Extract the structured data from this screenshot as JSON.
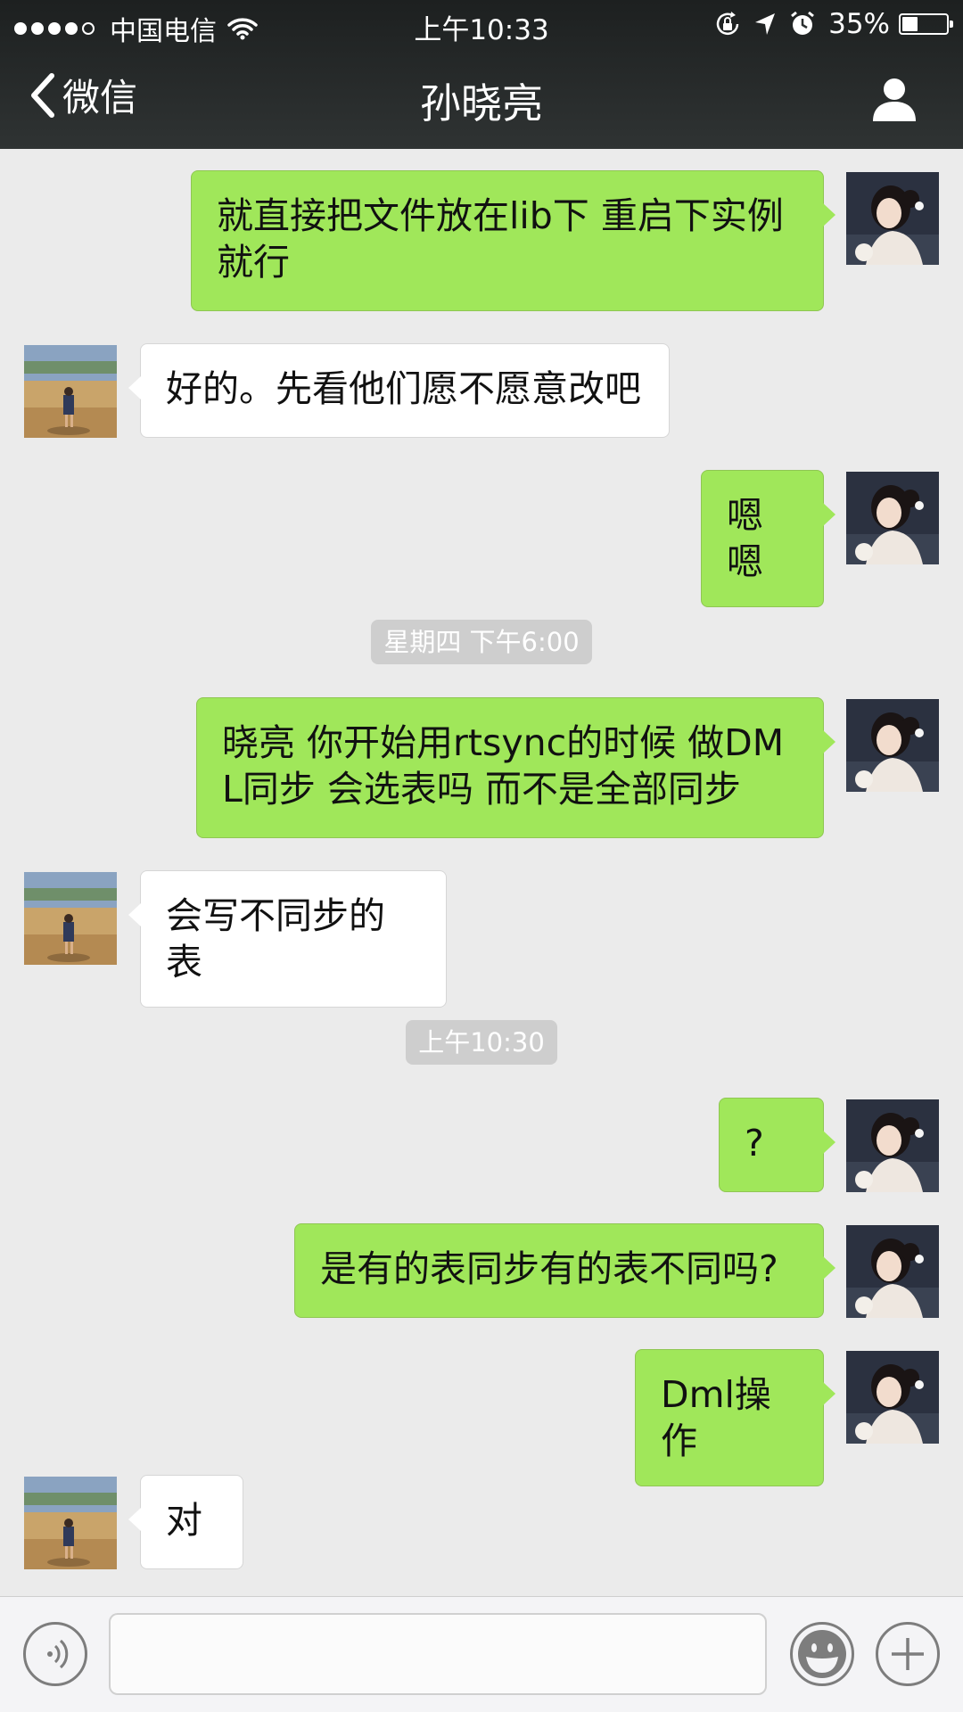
{
  "status_bar": {
    "signal_dots": 5,
    "signal_filled": 4,
    "carrier": "中国电信",
    "time": "上午10:33",
    "battery": "35%",
    "battery_level": 0.35
  },
  "nav": {
    "back_label": "微信",
    "title": "孙晓亮"
  },
  "messages": [
    {
      "type": "message",
      "sender": "me",
      "text": "就直接把文件放在lib下  重启下实例就行"
    },
    {
      "type": "message",
      "sender": "them",
      "text": "好的。先看他们愿不愿意改吧"
    },
    {
      "type": "message",
      "sender": "me",
      "text": "嗯嗯"
    },
    {
      "type": "time",
      "text": "星期四 下午6:00"
    },
    {
      "type": "message",
      "sender": "me",
      "text": "晓亮 你开始用rtsync的时候 做DML同步 会选表吗 而不是全部同步"
    },
    {
      "type": "message",
      "sender": "them",
      "text": "会写不同步的表"
    },
    {
      "type": "time",
      "text": "上午10:30"
    },
    {
      "type": "message",
      "sender": "me",
      "text": "?"
    },
    {
      "type": "message",
      "sender": "me",
      "text": "是有的表同步有的表不同吗?"
    },
    {
      "type": "message",
      "sender": "me",
      "text": "Dml操作"
    },
    {
      "type": "message",
      "sender": "them",
      "text": "对"
    }
  ],
  "input": {
    "value": "",
    "placeholder": ""
  },
  "colors": {
    "my_bubble": "#a0e75a",
    "their_bubble": "#ffffff",
    "background": "#ebebeb",
    "header": "#2f3333"
  },
  "icons": [
    "wifi-icon",
    "rotation-lock-icon",
    "location-arrow-icon",
    "alarm-icon",
    "battery-icon",
    "back-chevron-icon",
    "profile-icon",
    "voice-icon",
    "emoji-icon",
    "plus-icon"
  ]
}
